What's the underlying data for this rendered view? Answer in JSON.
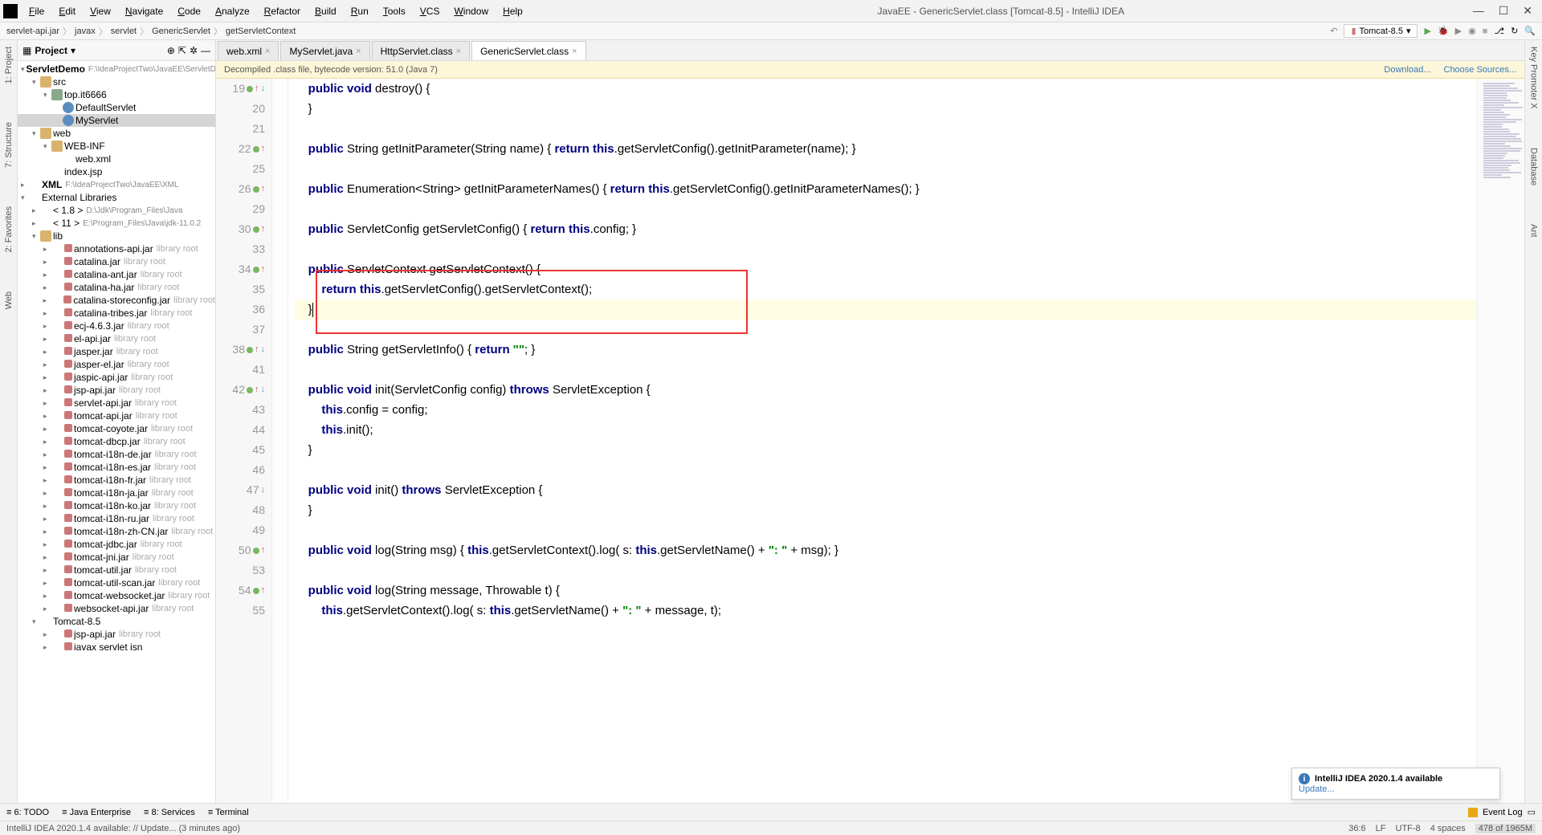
{
  "window_title": "JavaEE - GenericServlet.class [Tomcat-8.5] - IntelliJ IDEA",
  "menus": [
    "File",
    "Edit",
    "View",
    "Navigate",
    "Code",
    "Analyze",
    "Refactor",
    "Build",
    "Run",
    "Tools",
    "VCS",
    "Window",
    "Help"
  ],
  "breadcrumb": [
    "servlet-api.jar",
    "javax",
    "servlet",
    "GenericServlet",
    "getServletContext"
  ],
  "run_config": "Tomcat-8.5",
  "project_panel_title": "Project",
  "tree": {
    "root": "ServletDemo",
    "root_path": "F:\\IdeaProjectTwo\\JavaEE\\ServletD",
    "src": "src",
    "pkg": "top.it6666",
    "classes": [
      "DefaultServlet",
      "MyServlet"
    ],
    "web": "web",
    "webinf": "WEB-INF",
    "webxml": "web.xml",
    "indexjsp": "index.jsp",
    "xml_group": "XML",
    "xml_path": "F:\\IdeaProjectTwo\\JavaEE\\XML",
    "ext_libs": "External Libraries",
    "jdk18": "< 1.8 >",
    "jdk18_path": "D:\\Jdk\\Program_Files\\Java",
    "jdk11": "< 11 >",
    "jdk11_path": "E:\\Program_Files\\Java\\jdk-11.0.2",
    "lib": "lib",
    "jars": [
      "annotations-api.jar",
      "catalina.jar",
      "catalina-ant.jar",
      "catalina-ha.jar",
      "catalina-storeconfig.jar",
      "catalina-tribes.jar",
      "ecj-4.6.3.jar",
      "el-api.jar",
      "jasper.jar",
      "jasper-el.jar",
      "jaspic-api.jar",
      "jsp-api.jar",
      "servlet-api.jar",
      "tomcat-api.jar",
      "tomcat-coyote.jar",
      "tomcat-dbcp.jar",
      "tomcat-i18n-de.jar",
      "tomcat-i18n-es.jar",
      "tomcat-i18n-fr.jar",
      "tomcat-i18n-ja.jar",
      "tomcat-i18n-ko.jar",
      "tomcat-i18n-ru.jar",
      "tomcat-i18n-zh-CN.jar",
      "tomcat-jdbc.jar",
      "tomcat-jni.jar",
      "tomcat-util.jar",
      "tomcat-util-scan.jar",
      "tomcat-websocket.jar",
      "websocket-api.jar"
    ],
    "tomcat_group": "Tomcat-8.5",
    "tomcat_jars": [
      "jsp-api.jar"
    ],
    "tomcat_last": "iavax servlet isn",
    "lib_root_label": "library root"
  },
  "left_tabs": [
    "1: Project",
    "7: Structure",
    "2: Favorites",
    "Web"
  ],
  "right_tabs": [
    "Key Promoter X",
    "Database",
    "Ant"
  ],
  "editor_tabs": [
    {
      "name": "web.xml",
      "active": false
    },
    {
      "name": "MyServlet.java",
      "active": false
    },
    {
      "name": "HttpServlet.class",
      "active": false
    },
    {
      "name": "GenericServlet.class",
      "active": true
    }
  ],
  "banner_text": "Decompiled .class file, bytecode version: 51.0 (Java 7)",
  "banner_links": [
    "Download...",
    "Choose Sources..."
  ],
  "code_lines": [
    {
      "n": 19,
      "markers": [
        "green",
        "up",
        "down"
      ],
      "html": "    <span class='kw'>public</span> <span class='kw'>void</span> destroy() {"
    },
    {
      "n": 20,
      "markers": [],
      "html": "    }"
    },
    {
      "n": 21,
      "markers": [],
      "html": ""
    },
    {
      "n": 22,
      "markers": [
        "green",
        "up"
      ],
      "html": "    <span class='kw'>public</span> String getInitParameter(String name) { <span class='kw'>return</span> <span class='kw'>this</span>.getServletConfig().getInitParameter(name); }"
    },
    {
      "n": 25,
      "markers": [],
      "html": ""
    },
    {
      "n": 26,
      "markers": [
        "green",
        "up"
      ],
      "html": "    <span class='kw'>public</span> Enumeration&lt;String&gt; getInitParameterNames() { <span class='kw'>return</span> <span class='kw'>this</span>.getServletConfig().getInitParameterNames(); }"
    },
    {
      "n": 29,
      "markers": [],
      "html": ""
    },
    {
      "n": 30,
      "markers": [
        "green",
        "up"
      ],
      "html": "    <span class='kw'>public</span> ServletConfig getServletConfig() { <span class='kw'>return</span> <span class='kw'>this</span>.config; }"
    },
    {
      "n": 33,
      "markers": [],
      "html": ""
    },
    {
      "n": 34,
      "markers": [
        "green",
        "up"
      ],
      "html": "    <span class='kw'>public</span> ServletContext getServletContext() {"
    },
    {
      "n": 35,
      "markers": [],
      "html": "        <span class='kw'>return</span> <span class='kw'>this</span>.getServletConfig().getServletContext();"
    },
    {
      "n": 36,
      "markers": [],
      "hl": true,
      "html": "    }<span class='caret'></span>"
    },
    {
      "n": 37,
      "markers": [],
      "html": ""
    },
    {
      "n": 38,
      "markers": [
        "green",
        "up",
        "down"
      ],
      "html": "    <span class='kw'>public</span> String getServletInfo() { <span class='kw'>return</span> <span class='str'>\"\"</span>; }"
    },
    {
      "n": 41,
      "markers": [],
      "html": ""
    },
    {
      "n": 42,
      "markers": [
        "green",
        "up",
        "down"
      ],
      "html": "    <span class='kw'>public</span> <span class='kw'>void</span> init(ServletConfig config) <span class='kw'>throws</span> ServletException {"
    },
    {
      "n": 43,
      "markers": [],
      "html": "        <span class='kw'>this</span>.config = config;"
    },
    {
      "n": 44,
      "markers": [],
      "html": "        <span class='kw'>this</span>.init();"
    },
    {
      "n": 45,
      "markers": [],
      "html": "    }"
    },
    {
      "n": 46,
      "markers": [],
      "html": ""
    },
    {
      "n": 47,
      "markers": [
        "down"
      ],
      "html": "    <span class='kw'>public</span> <span class='kw'>void</span> init() <span class='kw'>throws</span> ServletException {"
    },
    {
      "n": 48,
      "markers": [],
      "html": "    }"
    },
    {
      "n": 49,
      "markers": [],
      "html": ""
    },
    {
      "n": 50,
      "markers": [
        "green",
        "up"
      ],
      "html": "    <span class='kw'>public</span> <span class='kw'>void</span> log(String msg) { <span class='kw'>this</span>.getServletContext().log( s: <span class='kw'>this</span>.getServletName() + <span class='str'>\": \"</span> + msg); }"
    },
    {
      "n": 53,
      "markers": [],
      "html": ""
    },
    {
      "n": 54,
      "markers": [
        "green",
        "up"
      ],
      "html": "    <span class='kw'>public</span> <span class='kw'>void</span> log(String message, Throwable t) {"
    },
    {
      "n": 55,
      "markers": [],
      "html": "        <span class='kw'>this</span>.getServletContext().log( s: <span class='kw'>this</span>.getServletName() + <span class='str'>\": \"</span> + message, t);"
    }
  ],
  "bottom_tabs": [
    "6: TODO",
    "Java Enterprise",
    "8: Services",
    "Terminal"
  ],
  "event_log": "Event Log",
  "status_left": "IntelliJ IDEA 2020.1.4 available: // Update... (3 minutes ago)",
  "status_right": [
    "36:6",
    "LF",
    "UTF-8",
    "4 spaces",
    "478 of 1965M"
  ],
  "notification": {
    "title": "IntelliJ IDEA 2020.1.4 available",
    "action": "Update..."
  }
}
